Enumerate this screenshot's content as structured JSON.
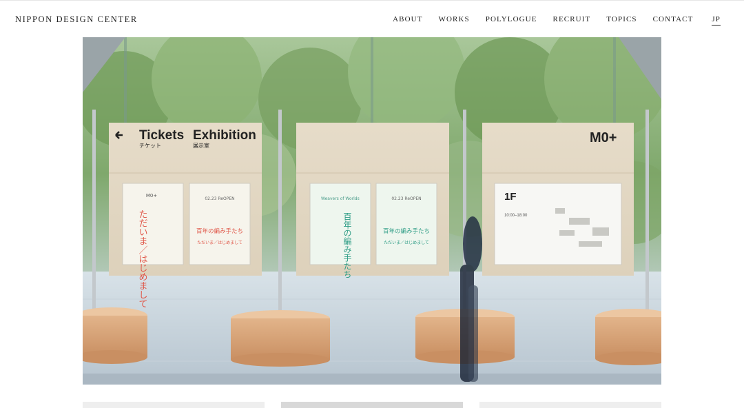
{
  "header": {
    "logo": "NIPPON DESIGN CENTER",
    "nav": [
      {
        "label": "ABOUT"
      },
      {
        "label": "WORKS"
      },
      {
        "label": "POLYLOGUE"
      },
      {
        "label": "RECRUIT"
      },
      {
        "label": "TOPICS"
      },
      {
        "label": "CONTACT"
      }
    ],
    "lang": "JP"
  },
  "hero": {
    "sign_left": {
      "arrow_icon": "arrow-left-icon",
      "tickets_en": "Tickets",
      "tickets_ja": "チケット",
      "exhibition_en": "Exhibition",
      "exhibition_ja": "展示室"
    },
    "sign_right": {
      "brand": "M0+",
      "floor": "1F",
      "hours": "10:00–18:00"
    },
    "poster_a": {
      "title": "ただいま／はじめまして",
      "brand": "M0+"
    },
    "poster_b": {
      "date": "02.23 ReOPEN",
      "title": "百年の編み手たち",
      "subtitle": "ただいま／はじめまして"
    },
    "poster_c": {
      "label": "Weavers of Worlds",
      "title": "百年の編み手たち"
    },
    "poster_d": {
      "date": "02.23 ReOPEN",
      "title": "百年の編み手たち",
      "subtitle": "ただいま／はじめまして"
    }
  }
}
